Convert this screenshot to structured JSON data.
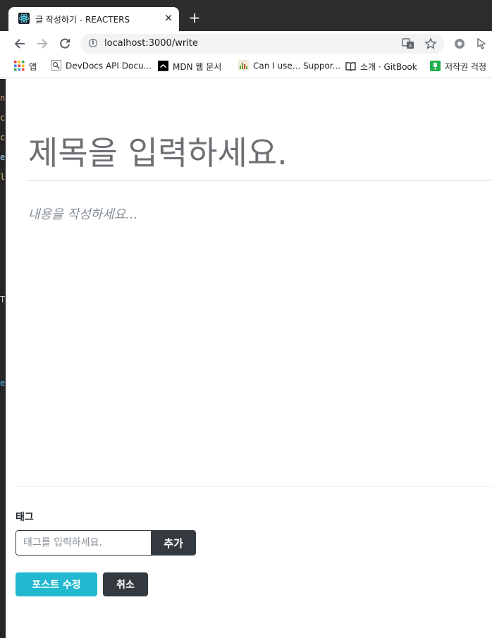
{
  "browser": {
    "tab_title": "글 작성하기 - REACTERS",
    "tab_close": "×",
    "new_tab": "+",
    "url": "localhost:3000/write",
    "info_icon": "i",
    "icons": [
      "back-arrow-icon",
      "forward-arrow-icon",
      "reload-icon",
      "info-icon",
      "translate-icon",
      "star-icon",
      "extension-icon",
      "cursor-icon"
    ]
  },
  "bookmarks": [
    {
      "label": "앱",
      "icon": "apps-grid-icon"
    },
    {
      "label": "DevDocs API Docu...",
      "icon": "devdocs-icon"
    },
    {
      "label": "MDN 웹 문서",
      "icon": "mdn-icon"
    },
    {
      "label": "Can I use... Suppor...",
      "icon": "caniuse-icon"
    },
    {
      "label": "소개 · GitBook",
      "icon": "book-icon"
    },
    {
      "label": "저작권 걱정",
      "icon": "copyright-icon"
    }
  ],
  "editor": {
    "title_placeholder": "제목을 입력하세요.",
    "content_placeholder": "내용을 작성하세요..."
  },
  "tags": {
    "heading": "태그",
    "input_placeholder": "태그를 입력하세요.",
    "add_label": "추가"
  },
  "actions": {
    "submit_label": "포스트 수정",
    "cancel_label": "취소"
  },
  "colors": {
    "accent": "#22b8cf",
    "dark": "#343a40",
    "chrome_dark": "#2d2d30"
  }
}
